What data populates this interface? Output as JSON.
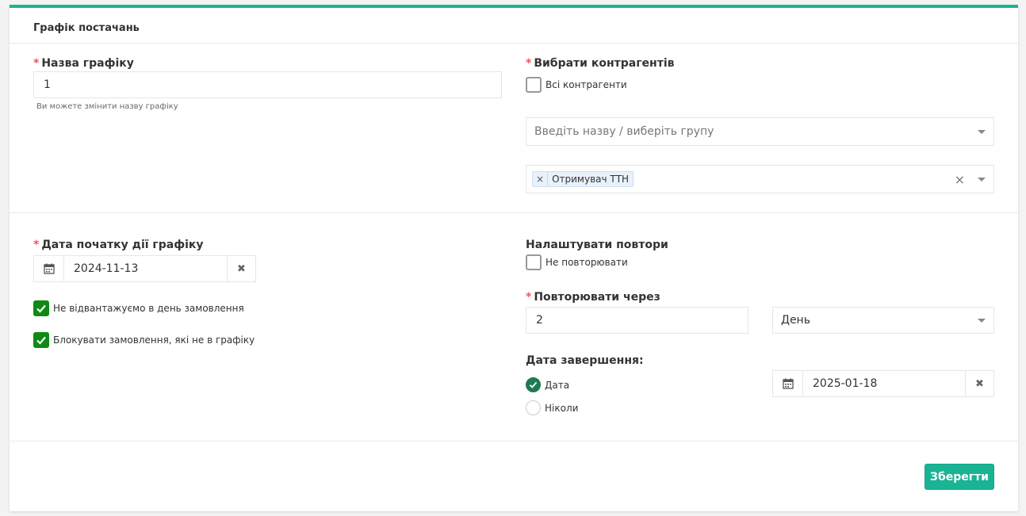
{
  "panel": {
    "title": "Графік постачань"
  },
  "schedule_name": {
    "label": "Назва графіку",
    "value": "1",
    "hint": "Ви можете змінити назву графіку"
  },
  "contractors": {
    "label": "Вибрати контрагентів",
    "all_label": "Всі контрагенти",
    "all_checked": false,
    "group_placeholder": "Введіть назву / виберіть групу",
    "selected_tag": "Отримувач ТТН",
    "tag_remove": "×",
    "clear_symbol": "×"
  },
  "start_date": {
    "label": "Дата початку дії графіку",
    "value": "2024-11-13",
    "clear_symbol": "✖"
  },
  "options": [
    {
      "label": "Не відвантажуємо в день замовлення",
      "checked": true
    },
    {
      "label": "Блокувати замовлення, які не в графіку",
      "checked": true
    }
  ],
  "repeat": {
    "label": "Налаштувати повтори",
    "no_repeat_label": "Не повторювати",
    "no_repeat_checked": false,
    "every_label": "Повторювати через",
    "every_value": "2",
    "unit_value": "День"
  },
  "end_date": {
    "label": "Дата завершення:",
    "option_date": "Дата",
    "option_never": "Ніколи",
    "selected": "date",
    "value": "2025-01-18",
    "clear_symbol": "✖"
  },
  "save_button": "Зберегти",
  "colors": {
    "accent": "#1ab394",
    "checkbox": "#0f8a14",
    "required": "#ed5565"
  }
}
